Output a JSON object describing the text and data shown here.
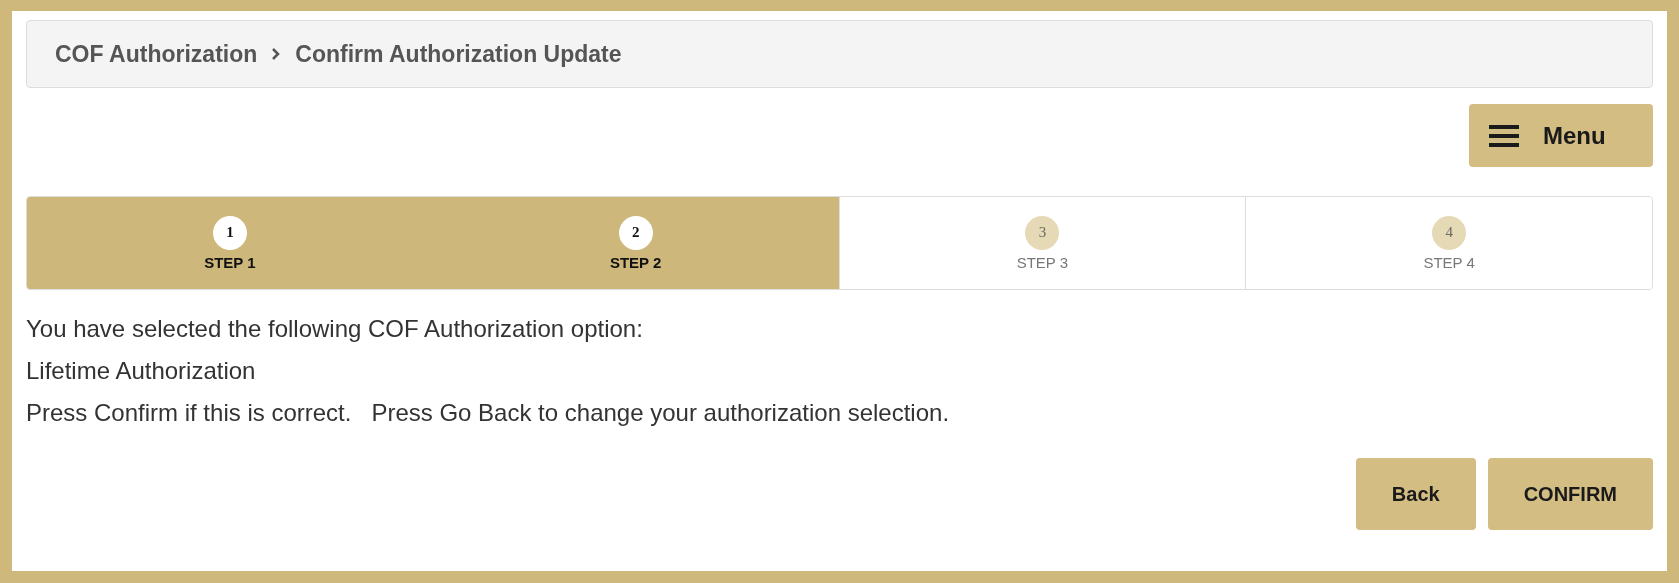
{
  "breadcrumb": [
    {
      "label": "COF Authorization"
    },
    {
      "label": "Confirm Authorization Update"
    }
  ],
  "menu_button": {
    "label": "Menu"
  },
  "steps": [
    {
      "number": "1",
      "label": "STEP 1",
      "completed": true
    },
    {
      "number": "2",
      "label": "STEP 2",
      "completed": true
    },
    {
      "number": "3",
      "label": "STEP 3",
      "completed": false
    },
    {
      "number": "4",
      "label": "STEP 4",
      "completed": false
    }
  ],
  "message_lines": [
    "You have selected the following COF Authorization option:",
    "Lifetime Authorization",
    "Press Confirm if this is correct.   Press Go Back to change your authorization selection."
  ],
  "buttons": [
    {
      "label": "Back"
    },
    {
      "label": "CONFIRM"
    }
  ]
}
